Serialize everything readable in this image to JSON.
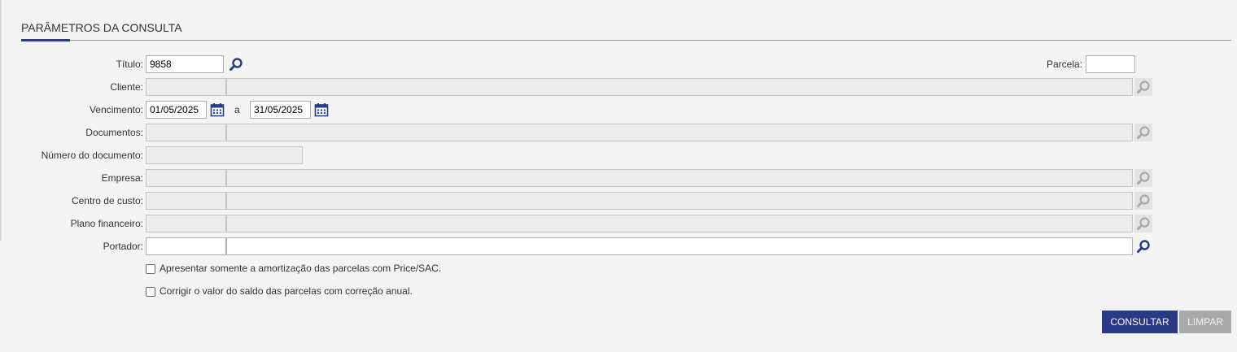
{
  "section": {
    "title": "PARÂMETROS DA CONSULTA"
  },
  "fields": {
    "titulo": {
      "label": "Título:",
      "value": "9858"
    },
    "parcela": {
      "label": "Parcela:",
      "value": ""
    },
    "cliente": {
      "label": "Cliente:",
      "code": "",
      "description": ""
    },
    "vencimento": {
      "label": "Vencimento:",
      "from": "01/05/2025",
      "separator": "a",
      "to": "31/05/2025"
    },
    "documentos": {
      "label": "Documentos:",
      "code": "",
      "description": ""
    },
    "numero_documento": {
      "label": "Número do documento:",
      "value": ""
    },
    "empresa": {
      "label": "Empresa:",
      "code": "",
      "description": ""
    },
    "centro_custo": {
      "label": "Centro de custo:",
      "code": "",
      "description": ""
    },
    "plano_financeiro": {
      "label": "Plano financeiro:",
      "code": "",
      "description": ""
    },
    "portador": {
      "label": "Portador:",
      "code": "",
      "description": ""
    }
  },
  "options": {
    "price_sac": {
      "label": "Apresentar somente a amortização das parcelas com Price/SAC.",
      "checked": false
    },
    "correcao_anual": {
      "label": "Corrigir o valor do saldo das parcelas com correção anual.",
      "checked": false
    }
  },
  "actions": {
    "consultar": "CONSULTAR",
    "limpar": "LIMPAR"
  },
  "icons": {
    "lookup": "magnifier-icon",
    "calendar": "calendar-icon"
  },
  "colors": {
    "primary": "#2b3a86",
    "disabled_button": "#a9a9a9",
    "disabled_field": "#ececec"
  }
}
